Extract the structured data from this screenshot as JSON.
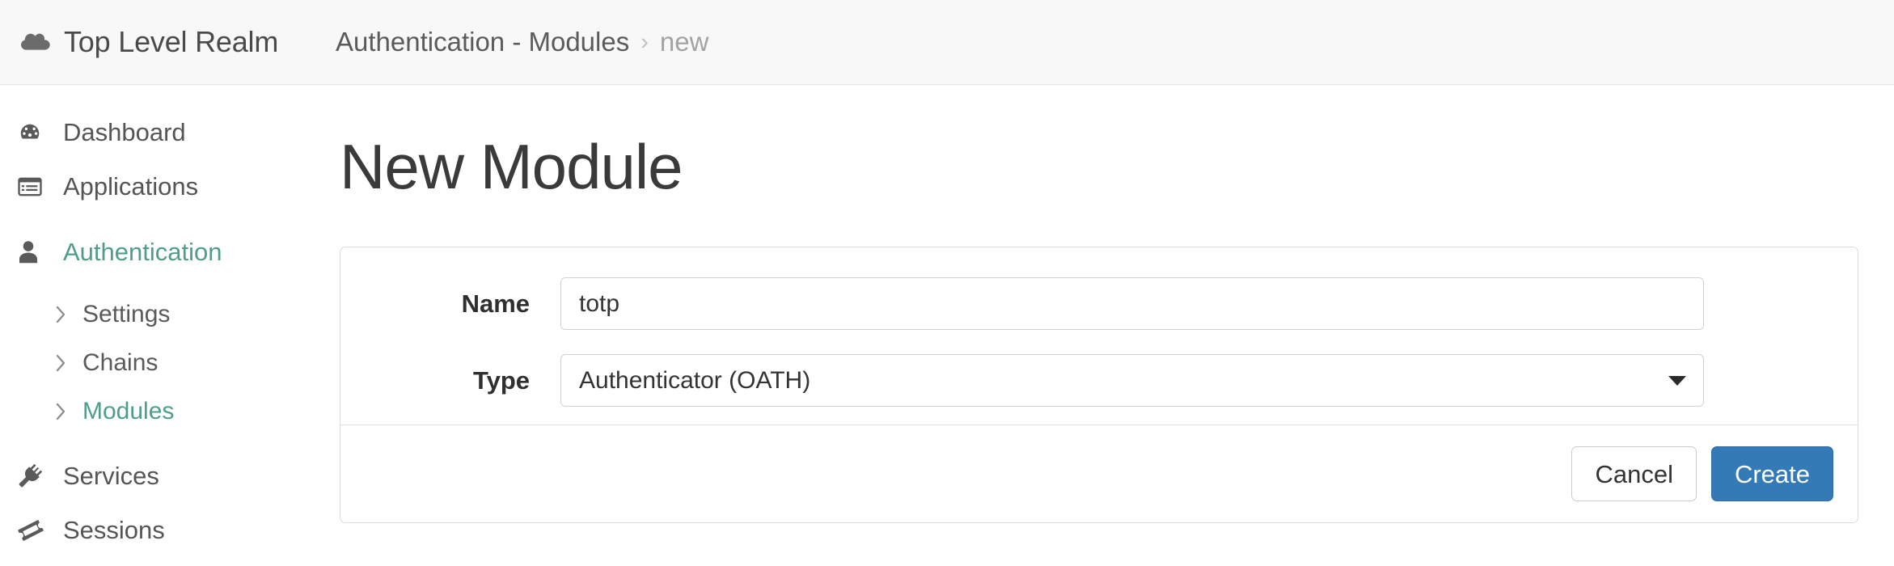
{
  "header": {
    "realm": {
      "icon": "cloud-icon",
      "title": "Top Level Realm"
    },
    "breadcrumb": {
      "parent": "Authentication - Modules",
      "separator": "›",
      "current": "new"
    }
  },
  "sidebar": {
    "items": [
      {
        "label": "Dashboard",
        "icon": "dashboard-gauge-icon",
        "active": false
      },
      {
        "label": "Applications",
        "icon": "applications-list-icon",
        "active": false
      },
      {
        "label": "Authentication",
        "icon": "user-person-icon",
        "active": true
      },
      {
        "label": "Services",
        "icon": "plug-icon",
        "active": false
      },
      {
        "label": "Sessions",
        "icon": "ticket-tag-icon",
        "active": false
      }
    ],
    "sub_items": [
      {
        "label": "Settings",
        "icon": "chevron-right-icon",
        "active": false
      },
      {
        "label": "Chains",
        "icon": "chevron-right-icon",
        "active": false
      },
      {
        "label": "Modules",
        "icon": "chevron-right-icon",
        "active": true
      }
    ]
  },
  "main": {
    "title": "New Module",
    "form": {
      "name": {
        "label": "Name",
        "value": "totp",
        "placeholder": ""
      },
      "type": {
        "label": "Type",
        "value": "Authenticator (OATH)",
        "caret_icon": "caret-down-icon"
      }
    },
    "footer": {
      "cancel_label": "Cancel",
      "create_label": "Create"
    }
  },
  "colors": {
    "accent_teal": "#4f9e8a",
    "primary_blue": "#337ab7",
    "primary_blue_border": "#2e6da4",
    "header_bg": "#f8f8f8",
    "border_gray": "#dcdcdc",
    "text_dark": "#3a3a3a",
    "text_muted": "#a3a3a3"
  }
}
